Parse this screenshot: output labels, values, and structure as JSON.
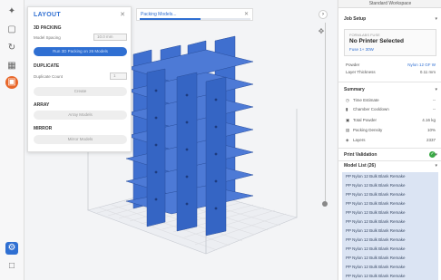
{
  "toolbar": {
    "tools": [
      {
        "icon": "wand-icon",
        "glyph": "✦"
      },
      {
        "icon": "crop-icon",
        "glyph": "▢"
      },
      {
        "icon": "rotate-icon",
        "glyph": "↻"
      },
      {
        "icon": "grid-icon",
        "glyph": "▦"
      },
      {
        "icon": "layout-icon",
        "glyph": "▣"
      }
    ],
    "bottom_tools": [
      {
        "icon": "settings-icon",
        "glyph": "⚙"
      },
      {
        "icon": "folder-icon",
        "glyph": "□"
      }
    ]
  },
  "layout_panel": {
    "title": "LAYOUT",
    "sections": {
      "packing_title": "3D PACKING",
      "model_spacing_label": "Model Spacing",
      "model_spacing_value": "10.0 mm",
      "pack_button": "Run 3D Packing on 26 Models",
      "duplicate_title": "DUPLICATE",
      "duplicate_count_label": "Duplicate Count",
      "duplicate_count_value": "1",
      "create_button": "Create",
      "array_title": "ARRAY",
      "array_button": "Array Models",
      "mirror_title": "MIRROR",
      "mirror_button": "Mirror Models"
    }
  },
  "packing": {
    "label": "Packing Models...",
    "progress_fraction": 0.55
  },
  "right_panel": {
    "header": "Standard Workspace",
    "job_setup": "Job Setup",
    "printer": {
      "small": "FORMLABS FUSE",
      "name": "No Printer Selected",
      "sub": "Fuse 1+ 30W"
    },
    "material_label": "Powder",
    "material_value": "Nylon 12 GF W",
    "layer_label": "Layer Thickness",
    "layer_value": "0.11 mm",
    "summary": "Summary",
    "summary_rows": [
      {
        "label": "Time Estimate",
        "value": "--"
      },
      {
        "label": "Chamber Cooldown",
        "value": "--"
      },
      {
        "label": "Total Powder",
        "value": "4.16 kg"
      },
      {
        "label": "Packing Density",
        "value": "10%"
      },
      {
        "label": "Layers",
        "value": "2337"
      }
    ],
    "validation": "Print Validation",
    "model_list_title": "Model List (26)",
    "models": [
      "PP Nylon 12 Bulk Blank Remake",
      "PP Nylon 12 Bulk Blank Remake",
      "PP Nylon 12 Bulk Blank Remake",
      "PP Nylon 12 Bulk Blank Remake",
      "PP Nylon 12 Bulk Blank Remake",
      "PP Nylon 12 Bulk Blank Remake",
      "PP Nylon 12 Bulk Blank Remake",
      "PP Nylon 12 Bulk Blank Remake",
      "PP Nylon 12 Bulk Blank Remake",
      "PP Nylon 12 Bulk Blank Remake",
      "PP Nylon 12 Bulk Blank Remake",
      "PP Nylon 12 Bulk Blank Remake"
    ]
  },
  "colors": {
    "accent": "#2f6fd2",
    "part": "#3f6fcf",
    "active_tool": "#e8672a",
    "ok": "#3aa845"
  }
}
